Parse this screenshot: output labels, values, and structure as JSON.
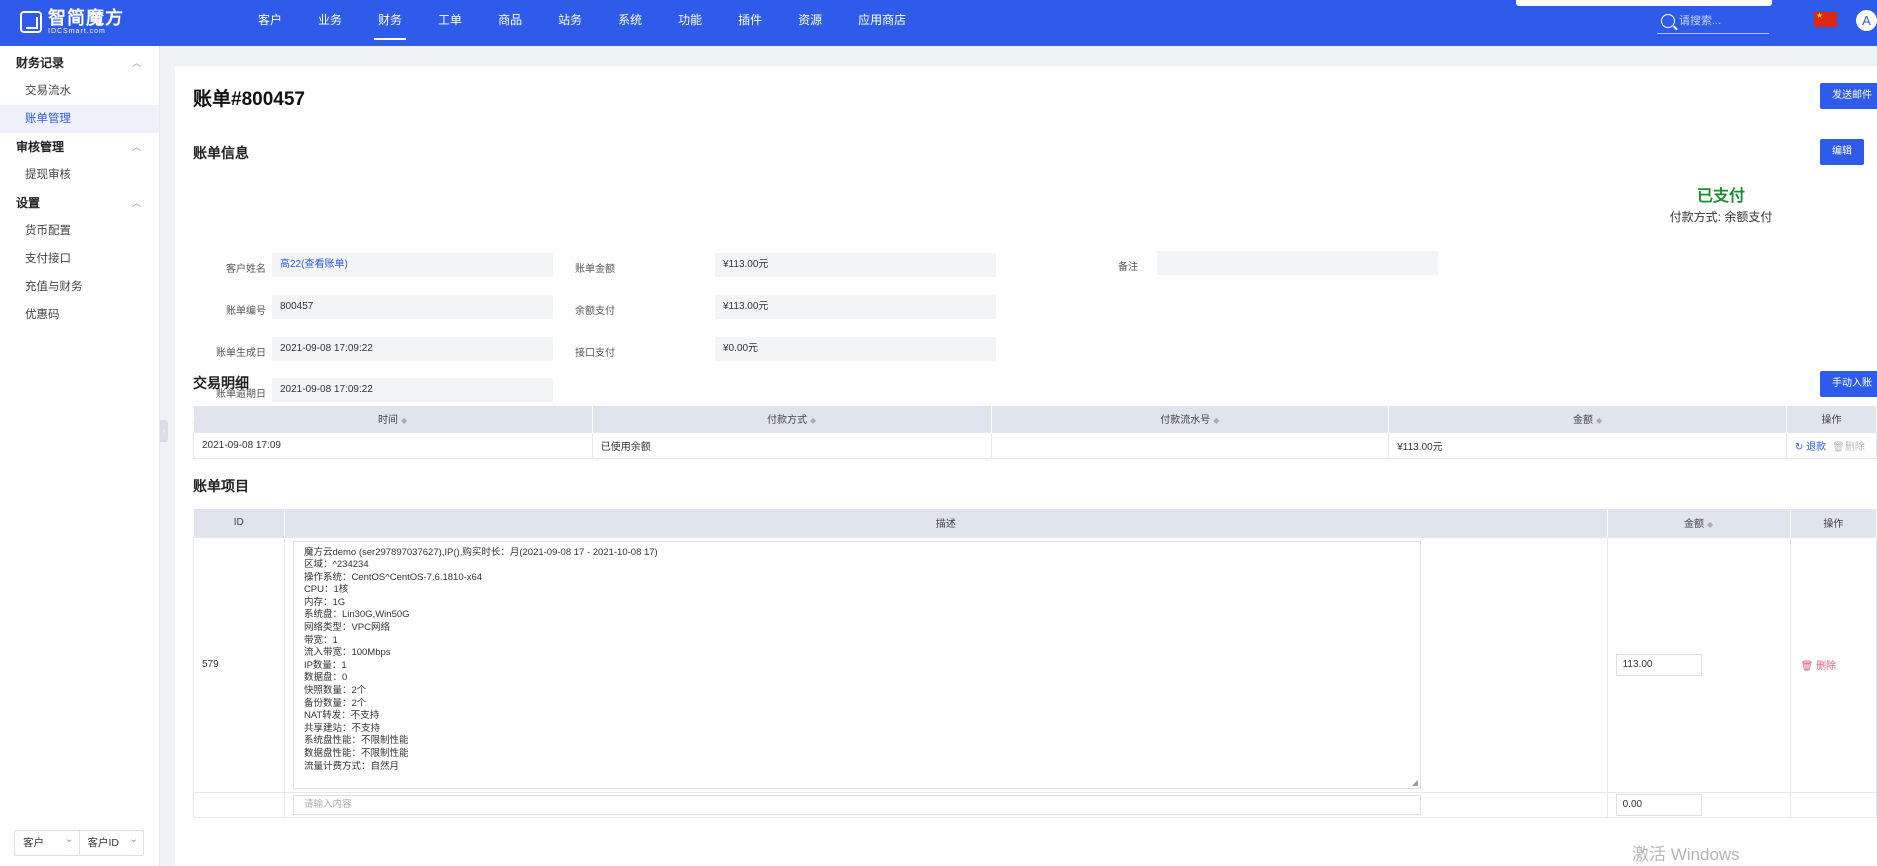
{
  "header": {
    "logo_title": "智简魔方",
    "logo_sub": "IDCSmart.com",
    "nav": [
      "客户",
      "业务",
      "财务",
      "工单",
      "商品",
      "站务",
      "系统",
      "功能",
      "插件",
      "资源",
      "应用商店"
    ],
    "active_nav": "财务",
    "search_placeholder": "请搜索...",
    "avatar": "A"
  },
  "sidebar": {
    "groups": [
      {
        "label": "财务记录",
        "items": [
          "交易流水",
          "账单管理"
        ]
      },
      {
        "label": "审核管理",
        "items": [
          "提现审核"
        ]
      },
      {
        "label": "设置",
        "items": [
          "货币配置",
          "支付接口",
          "充值与财务",
          "优惠码"
        ]
      }
    ],
    "active_item": "账单管理",
    "bottom_select_1": "客户",
    "bottom_select_2": "客户ID"
  },
  "page": {
    "title": "账单#800457",
    "send_email_btn": "发送邮件",
    "info_title": "账单信息",
    "edit_btn": "编辑",
    "fields": {
      "client_name_label": "客户姓名",
      "client_name_value": "高22(查看账单)",
      "invoice_no_label": "账单编号",
      "invoice_no_value": "800457",
      "created_label": "账单生成日",
      "created_value": "2021-09-08 17:09:22",
      "due_label": "账单逾期日",
      "due_value": "2021-09-08 17:09:22",
      "amount_label": "账单金额",
      "amount_value": "¥113.00元",
      "balance_label": "余额支付",
      "balance_value": "¥113.00元",
      "gateway_label": "接口支付",
      "gateway_value": "¥0.00元",
      "note_label": "备注",
      "note_value": ""
    },
    "status": "已支付",
    "pay_method": "付款方式: 余额支付",
    "tx_title": "交易明细",
    "manual_btn": "手动入账",
    "tx_headers": [
      "时间",
      "付款方式",
      "付款流水号",
      "金额",
      "操作"
    ],
    "tx_rows": [
      {
        "time": "2021-09-08 17:09",
        "method": "已使用余额",
        "serial": "",
        "amount": "¥113.00元",
        "refund": "退款",
        "delete": "删除"
      }
    ],
    "items_title": "账单项目",
    "item_headers": [
      "ID",
      "描述",
      "金额",
      "操作"
    ],
    "items": [
      {
        "id": "579",
        "description": "魔方云demo (ser297897037627),IP(),购买时长：月(2021-09-08 17 - 2021-10-08 17)\n区域：^234234\n操作系统：CentOS^CentOS-7.6.1810-x64\nCPU：1核\n内存：1G\n系统盘：Lin30G,Win50G\n网络类型：VPC网络\n带宽：1\n流入带宽：100Mbps\nIP数量：1\n数据盘：0\n快照数量：2个\n备份数量：2个\nNAT转发：不支持\n共享建站：不支持\n系统盘性能：不限制性能\n数据盘性能：不限制性能\n流量计费方式：自然月",
        "amount": "113.00",
        "delete": "删除"
      }
    ],
    "new_item_placeholder": "请输入内容",
    "new_item_amount": "0.00",
    "watermark": "激活 Windows"
  },
  "colors": {
    "primary": "#2f5bea",
    "paid": "#1c8c2e"
  }
}
